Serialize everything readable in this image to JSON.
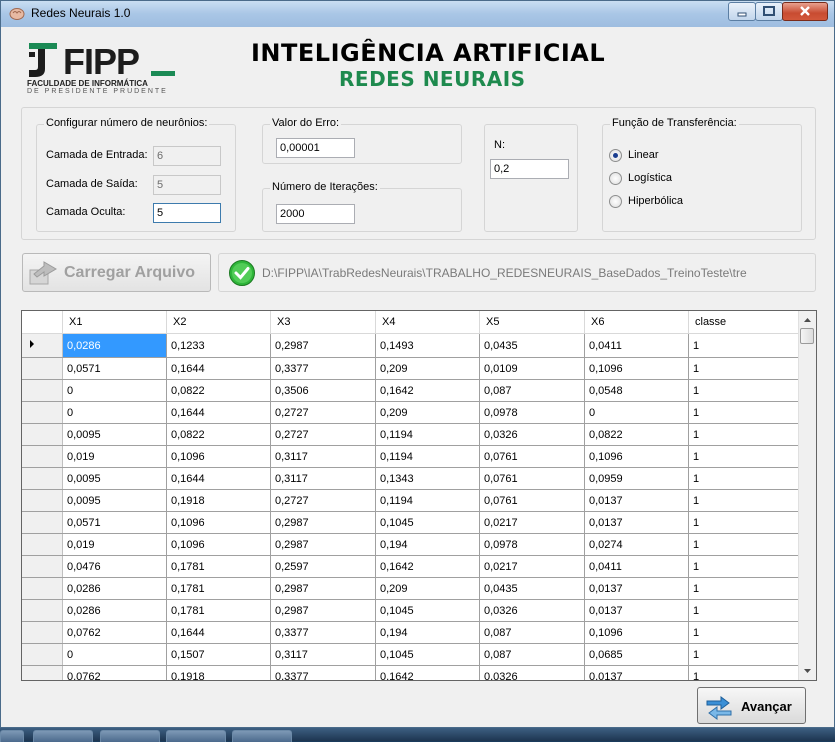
{
  "window": {
    "title": "Redes Neurais 1.0"
  },
  "header": {
    "logo_text": "FIPP",
    "logo_line1": "FACULDADE DE INFORMÁTICA",
    "logo_line2": "DE PRESIDENTE PRUDENTE",
    "title": "INTELIGÊNCIA ARTIFICIAL",
    "subtitle": "REDES NEURAIS"
  },
  "neurons": {
    "group_label": "Configurar número de neurônios:",
    "input_label": "Camada de Entrada:",
    "input_value": "6",
    "output_label": "Camada de Saída:",
    "output_value": "5",
    "hidden_label": "Camada Oculta:",
    "hidden_value": "5"
  },
  "error": {
    "group_label": "Valor do Erro:",
    "value": "0,00001"
  },
  "iterations": {
    "group_label": "Número de Iterações:",
    "value": "2000"
  },
  "n": {
    "label": "N:",
    "value": "0,2"
  },
  "transfer": {
    "group_label": "Função de Transferência:",
    "options": [
      "Linear",
      "Logística",
      "Hiperbólica"
    ],
    "selected": "Linear"
  },
  "load": {
    "button_label": "Carregar Arquivo",
    "file_path": "D:\\FIPP\\IA\\TrabRedesNeurais\\TRABALHO_REDESNEURAIS_BaseDados_TreinoTeste\\tre"
  },
  "table": {
    "columns": [
      "X1",
      "X2",
      "X3",
      "X4",
      "X5",
      "X6",
      "classe"
    ],
    "rows": [
      [
        "0,0286",
        "0,1233",
        "0,2987",
        "0,1493",
        "0,0435",
        "0,0411",
        "1"
      ],
      [
        "0,0571",
        "0,1644",
        "0,3377",
        "0,209",
        "0,0109",
        "0,1096",
        "1"
      ],
      [
        "0",
        "0,0822",
        "0,3506",
        "0,1642",
        "0,087",
        "0,0548",
        "1"
      ],
      [
        "0",
        "0,1644",
        "0,2727",
        "0,209",
        "0,0978",
        "0",
        "1"
      ],
      [
        "0,0095",
        "0,0822",
        "0,2727",
        "0,1194",
        "0,0326",
        "0,0822",
        "1"
      ],
      [
        "0,019",
        "0,1096",
        "0,3117",
        "0,1194",
        "0,0761",
        "0,1096",
        "1"
      ],
      [
        "0,0095",
        "0,1644",
        "0,3117",
        "0,1343",
        "0,0761",
        "0,0959",
        "1"
      ],
      [
        "0,0095",
        "0,1918",
        "0,2727",
        "0,1194",
        "0,0761",
        "0,0137",
        "1"
      ],
      [
        "0,0571",
        "0,1096",
        "0,2987",
        "0,1045",
        "0,0217",
        "0,0137",
        "1"
      ],
      [
        "0,019",
        "0,1096",
        "0,2987",
        "0,194",
        "0,0978",
        "0,0274",
        "1"
      ],
      [
        "0,0476",
        "0,1781",
        "0,2597",
        "0,1642",
        "0,0217",
        "0,0411",
        "1"
      ],
      [
        "0,0286",
        "0,1781",
        "0,2987",
        "0,209",
        "0,0435",
        "0,0137",
        "1"
      ],
      [
        "0,0286",
        "0,1781",
        "0,2987",
        "0,1045",
        "0,0326",
        "0,0137",
        "1"
      ],
      [
        "0,0762",
        "0,1644",
        "0,3377",
        "0,194",
        "0,087",
        "0,1096",
        "1"
      ],
      [
        "0",
        "0,1507",
        "0,3117",
        "0,1045",
        "0,087",
        "0,0685",
        "1"
      ],
      [
        "0,0762",
        "0,1918",
        "0,3377",
        "0,1642",
        "0,0326",
        "0,0137",
        "1"
      ]
    ]
  },
  "next": {
    "button_label": "Avançar"
  },
  "colors": {
    "accent_green": "#1e8a4e",
    "selection": "#3399ff"
  }
}
